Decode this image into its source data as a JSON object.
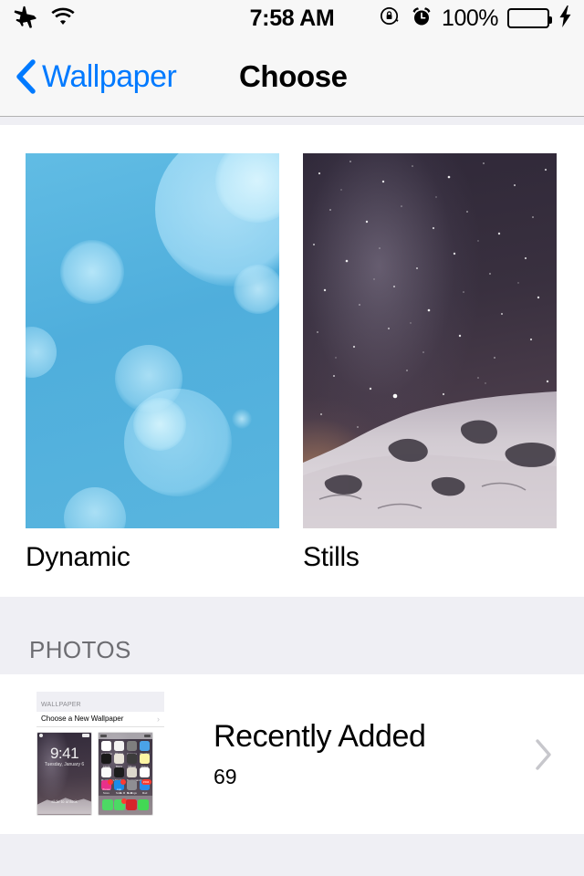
{
  "status_bar": {
    "airplane_icon": "airplane-icon",
    "wifi_icon": "wifi-icon",
    "time": "7:58 AM",
    "rotation_lock_icon": "rotation-lock-icon",
    "alarm_icon": "alarm-clock-icon",
    "battery_percent": "100%",
    "battery_level": 100,
    "battery_color": "#4CD964",
    "charging_icon": "lightning-bolt-icon"
  },
  "nav_bar": {
    "back_icon": "chevron-left-icon",
    "back_label": "Wallpaper",
    "title": "Choose",
    "accent_color": "#007AFF"
  },
  "wallpaper_types": [
    {
      "label": "Dynamic",
      "thumb": "dynamic-blue-bokeh"
    },
    {
      "label": "Stills",
      "thumb": "stills-milky-way-mountain"
    }
  ],
  "photos_section": {
    "header": "PHOTOS",
    "albums": [
      {
        "title": "Recently Added",
        "count": "69",
        "thumb_nav_title": "WALLPAPER",
        "thumb_row_label": "Choose a New Wallpaper",
        "thumb_row_chevron": "chevron-right-icon",
        "lock_preview_time": "9:41",
        "lock_preview_date": "Tuesday, January 6",
        "lock_preview_slide": "slide to unlock",
        "chevron": "chevron-right-icon"
      }
    ]
  },
  "home_preview_apps": [
    {
      "name": "Calendar",
      "color": "#FFFFFF"
    },
    {
      "name": "Photos",
      "color": "#F3F3F3"
    },
    {
      "name": "Camera",
      "color": "#7E7E7E"
    },
    {
      "name": "Weather",
      "color": "#4AA3E8"
    },
    {
      "name": "Clock",
      "color": "#1A1A1A"
    },
    {
      "name": "Maps",
      "color": "#E8E4D8"
    },
    {
      "name": "Videos",
      "color": "#3C3C3C"
    },
    {
      "name": "Notes",
      "color": "#FCF4A3"
    },
    {
      "name": "Reminders",
      "color": "#FAFAFA"
    },
    {
      "name": "Stocks",
      "color": "#1C1C1C"
    },
    {
      "name": "Newsstand",
      "color": "#DDD7CC"
    },
    {
      "name": "Health",
      "color": "#FFFFFF"
    },
    {
      "name": "iTunes Store",
      "color": "#E8308A"
    },
    {
      "name": "App Store",
      "color": "#1A8CE8"
    },
    {
      "name": "Settings",
      "color": "#8E8E93"
    },
    {
      "name": "Mail",
      "color": "#2C8BE8"
    }
  ],
  "dock_apps": [
    {
      "name": "Phone",
      "color": "#4CD964"
    },
    {
      "name": "Messages",
      "color": "#4CD964"
    },
    {
      "name": "Opera Mini",
      "color": "#D6252B"
    },
    {
      "name": "WhatsApp",
      "color": "#43D854"
    }
  ],
  "colors": {
    "accent": "#007AFF",
    "group_bg": "#EFEFF4",
    "bar_bg": "#F7F7F7",
    "section_text": "#6D6D72",
    "chevron_gray": "#C7C7CC"
  }
}
